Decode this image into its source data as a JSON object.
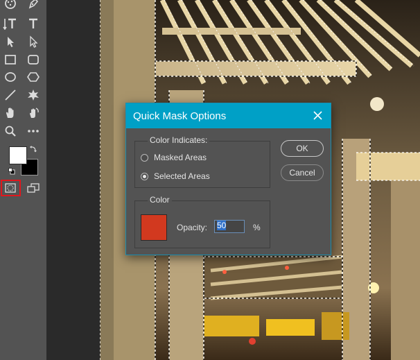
{
  "dialog": {
    "title": "Quick Mask Options",
    "color_indicates": {
      "label": "Color Indicates:",
      "options": [
        {
          "label": "Masked Areas",
          "checked": false
        },
        {
          "label": "Selected Areas",
          "checked": true
        }
      ]
    },
    "color": {
      "label": "Color",
      "swatch": "#d2391f",
      "opacity_label": "Opacity:",
      "opacity_value": "50",
      "opacity_unit": "%"
    },
    "ok_label": "OK",
    "cancel_label": "Cancel"
  },
  "toolbar": {
    "foreground_color": "#ffffff",
    "background_color": "#000000",
    "quick_mask_highlight": "#e1161c"
  }
}
